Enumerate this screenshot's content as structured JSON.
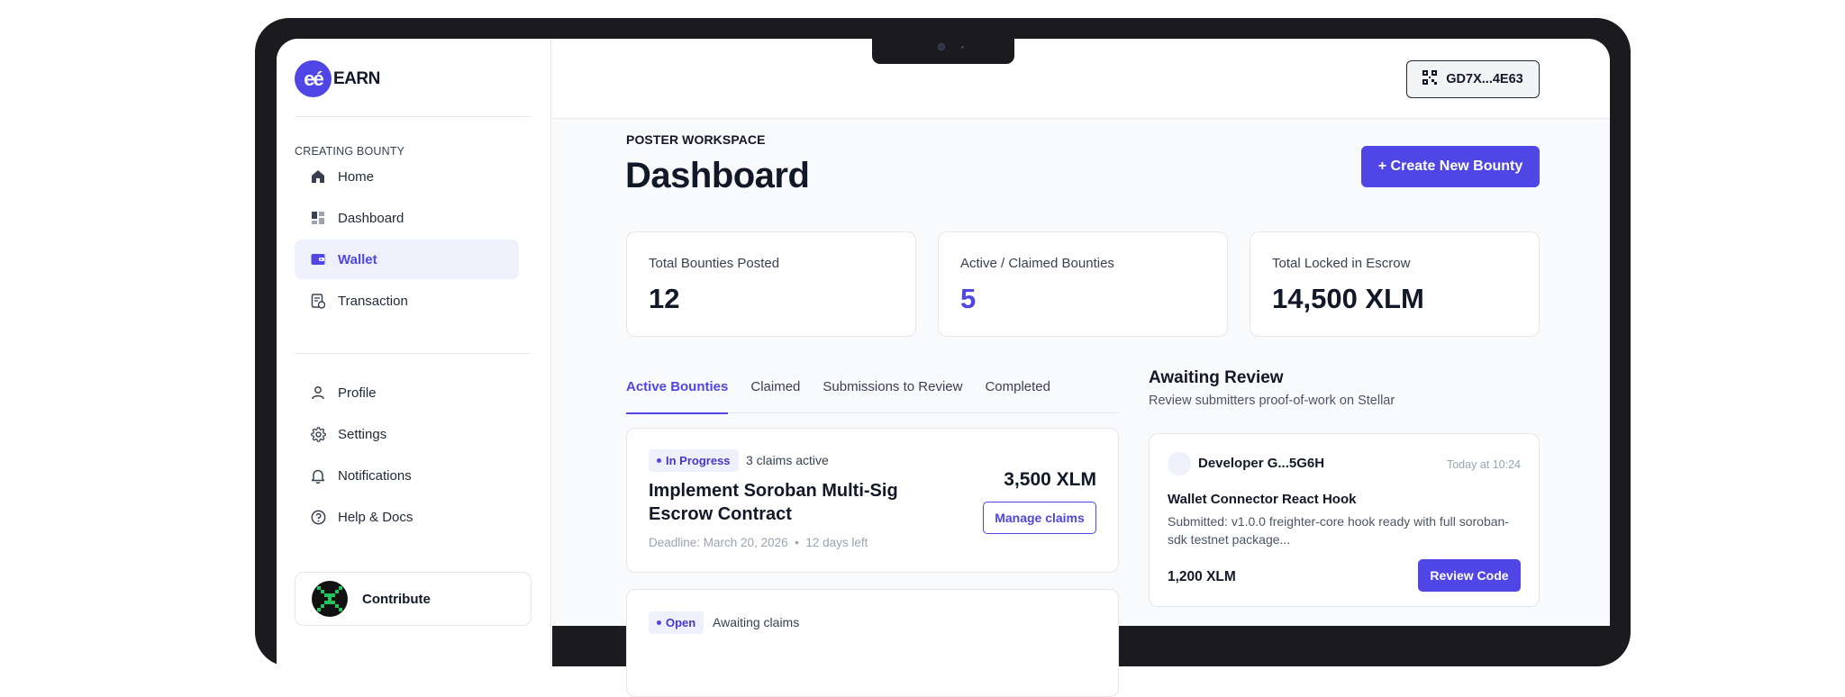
{
  "brand": {
    "logo_glyph": "eé",
    "name": "EARN",
    "accent": "#4f46e5"
  },
  "sidebar": {
    "section_label": "CREATING BOUNTY",
    "items": [
      {
        "label": "Home",
        "icon": "home-icon"
      },
      {
        "label": "Dashboard",
        "icon": "dashboard-icon"
      },
      {
        "label": "Wallet",
        "icon": "wallet-icon",
        "active": true
      },
      {
        "label": "Transaction",
        "icon": "transaction-icon"
      }
    ],
    "secondary_items": [
      {
        "label": "Profile",
        "icon": "user-icon"
      },
      {
        "label": "Settings",
        "icon": "gear-icon"
      },
      {
        "label": "Notifications",
        "icon": "bell-icon"
      },
      {
        "label": "Help & Docs",
        "icon": "help-icon"
      }
    ],
    "contribute_label": "Contribute"
  },
  "header": {
    "wallet_address": "GD7X...4E63"
  },
  "page": {
    "eyebrow": "POSTER WORKSPACE",
    "title": "Dashboard",
    "create_button": "+ Create New Bounty"
  },
  "stats": [
    {
      "label": "Total Bounties Posted",
      "value": "12"
    },
    {
      "label": "Active / Claimed Bounties",
      "value": "5"
    },
    {
      "label": "Total Locked in Escrow",
      "value": "14,500 XLM"
    }
  ],
  "tabs": [
    "Active Bounties",
    "Claimed",
    "Submissions to Review",
    "Completed"
  ],
  "bounties": [
    {
      "status": "In Progress",
      "claims": "3 claims active",
      "title": "Implement Soroban Multi-Sig Escrow Contract",
      "deadline": "Deadline: March 20, 2026",
      "time_left": "12 days left",
      "amount": "3,500 XLM",
      "action": "Manage claims"
    },
    {
      "status": "Open",
      "claims": "Awaiting claims"
    }
  ],
  "review": {
    "heading": "Awaiting Review",
    "subheading": "Review submitters proof-of-work on Stellar",
    "card": {
      "developer": "Developer G...5G6H",
      "time": "Today at 10:24",
      "title": "Wallet Connector React Hook",
      "description": "Submitted: v1.0.0 freighter-core hook ready with full soroban-sdk testnet package...",
      "amount": "1,200 XLM",
      "action": "Review Code"
    }
  }
}
